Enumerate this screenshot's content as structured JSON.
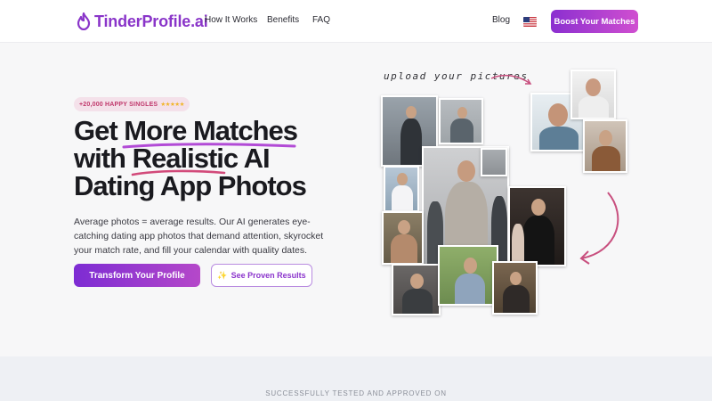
{
  "nav": {
    "logo_text": "TinderProfile.ai",
    "links": [
      "How It Works",
      "Benefits",
      "FAQ"
    ],
    "blog": "Blog",
    "cta": "Boost Your Matches",
    "language_flag": "us-flag-icon"
  },
  "hero": {
    "badge": "+20,000 HAPPY SINGLES",
    "badge_stars": "★★★★★",
    "headline_line1_a": "Get ",
    "headline_line1_b": "More Matches",
    "headline_line2_a": "with ",
    "headline_line2_b": "Realistic AI",
    "headline_line3": "Dating App Photos",
    "subtext": "Average photos = average results. Our AI generates eye-catching dating app photos that demand attention, skyrocket your match rate, and fill your calendar with quality dates.",
    "primary_cta": "Transform Your Profile",
    "secondary_cta": "See Proven Results",
    "secondary_icon": "sparkles-icon"
  },
  "collage": {
    "upload_note": "upload your pictures",
    "photo_count": 13
  },
  "trusted": {
    "label": "SUCCESSFULLY TESTED AND APPROVED ON"
  },
  "colors": {
    "brand_purple": "#8a35c9",
    "brand_pink": "#d04fd0",
    "accent_red": "#c0386c",
    "star_gold": "#f1b528"
  }
}
